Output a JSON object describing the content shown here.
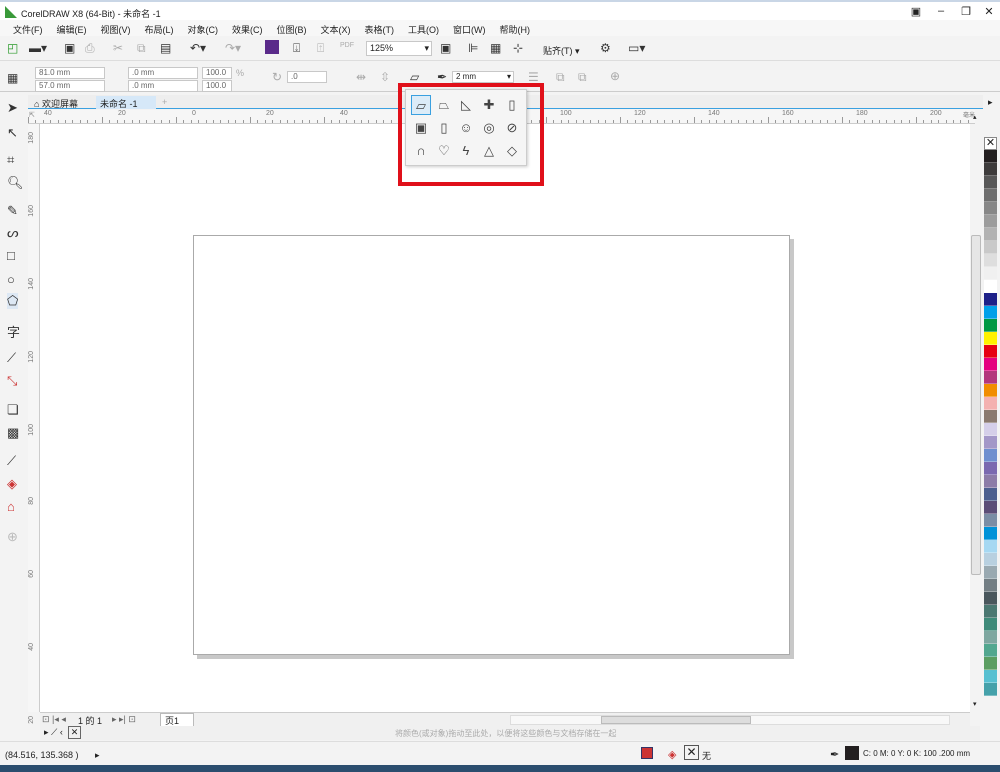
{
  "window": {
    "title": "CorelDRAW X8 (64-Bit) - 未命名 -1"
  },
  "menu": [
    "文件(F)",
    "编辑(E)",
    "视图(V)",
    "布局(L)",
    "对象(C)",
    "效果(C)",
    "位图(B)",
    "文本(X)",
    "表格(T)",
    "工具(O)",
    "窗口(W)",
    "帮助(H)"
  ],
  "toolbar": {
    "zoom": "125%",
    "snap": "贴齐(T)"
  },
  "propbar": {
    "x": "81.0 mm",
    "y": "57.0 mm",
    "w": ".0 mm",
    "h": ".0 mm",
    "sx": "100.0",
    "sy": "100.0",
    "pct": "%",
    "angle": ".0",
    "outline": "2 mm"
  },
  "tabs": {
    "welcome": "欢迎屏幕",
    "doc": "未命名 -1"
  },
  "hruler": [
    "40",
    "20",
    "0",
    "20",
    "40",
    "100",
    "120",
    "140",
    "160",
    "180",
    "200"
  ],
  "hruler_unit": "毫米",
  "vruler": [
    "180",
    "160",
    "140",
    "120",
    "100",
    "80",
    "60",
    "40",
    "20"
  ],
  "pagenav": {
    "text": "1 的 1",
    "page": "页1"
  },
  "docpal_hint": "将颜色(或对象)拖动至此处，以便将这些颜色与文档存储在一起",
  "status": {
    "coords": "(84.516, 135.368 )",
    "fill": "无",
    "outline": "C: 0 M: 0 Y: 0 K: 100  .200 mm"
  },
  "palette": [
    "#231f20",
    "#3d3b3b",
    "#575757",
    "#6e6e6e",
    "#878787",
    "#9c9c9c",
    "#b2b2b2",
    "#c9c9c9",
    "#dedede",
    "#f0f0f0",
    "#ffffff",
    "#1d2088",
    "#00a0e9",
    "#009944",
    "#fff100",
    "#e60012",
    "#e4007f",
    "#b3377c",
    "#f18d00",
    "#f4b1b0",
    "#8b7a6f",
    "#d5cfe9",
    "#a397c8",
    "#6f8fcf",
    "#7a69b0",
    "#8c7ca8",
    "#4c5f8f",
    "#5b4d77",
    "#7a8da5",
    "#0092d8",
    "#a6d8f2",
    "#b8d0e0",
    "#99a9b1",
    "#737e84",
    "#4a575d",
    "#4b7872",
    "#3f8b7a",
    "#7ea7a0",
    "#52a78f",
    "#5b9e62",
    "#57c0d1",
    "#45a1aa"
  ]
}
